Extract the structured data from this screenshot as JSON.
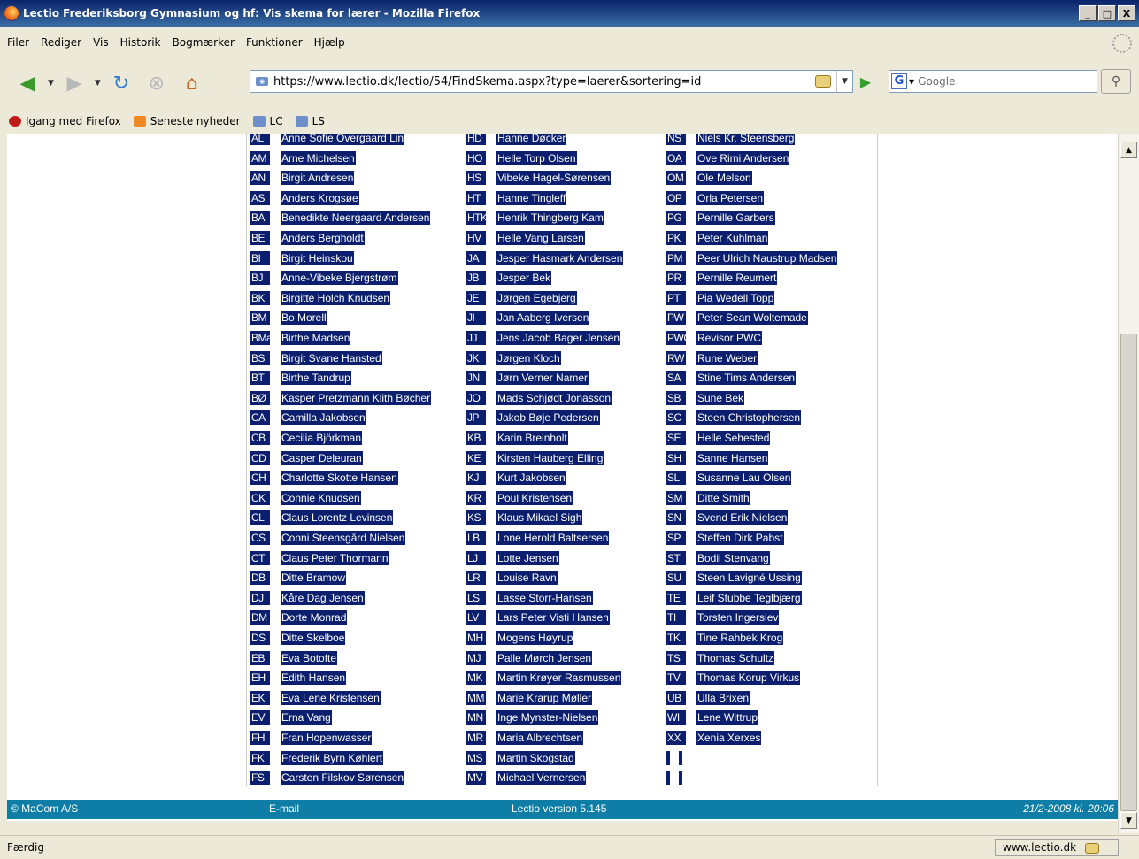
{
  "window": {
    "title": "Lectio Frederiksborg Gymnasium og hf: Vis skema for lærer - Mozilla Firefox",
    "controls": [
      "_",
      "□",
      "X"
    ]
  },
  "menu": [
    "Filer",
    "Rediger",
    "Vis",
    "Historik",
    "Bogmærker",
    "Funktioner",
    "Hjælp"
  ],
  "nav": {
    "url": "https://www.lectio.dk/lectio/54/FindSkema.aspx?type=laerer&sortering=id",
    "search_placeholder": "Google"
  },
  "bookmarks": [
    "Igang med Firefox",
    "Seneste nyheder",
    "LC",
    "LS"
  ],
  "teachers": {
    "col1": [
      [
        "AL",
        "Anne Sofie Overgaard Lin"
      ],
      [
        "AM",
        "Arne Michelsen"
      ],
      [
        "AN",
        "Birgit Andresen"
      ],
      [
        "AS",
        "Anders Krogsøe"
      ],
      [
        "BA",
        "Benedikte Neergaard Andersen"
      ],
      [
        "BE",
        "Anders Bergholdt"
      ],
      [
        "BI",
        "Birgit Heinskou"
      ],
      [
        "BJ",
        "Anne-Vibeke Bjergstrøm"
      ],
      [
        "BK",
        "Birgitte Holch Knudsen"
      ],
      [
        "BM",
        "Bo Morell"
      ],
      [
        "BMa",
        "Birthe Madsen"
      ],
      [
        "BS",
        "Birgit Svane Hansted"
      ],
      [
        "BT",
        "Birthe Tandrup"
      ],
      [
        "BØ",
        "Kasper Pretzmann Klith Bøcher"
      ],
      [
        "CA",
        "Camilla Jakobsen"
      ],
      [
        "CB",
        "Cecilia Björkman"
      ],
      [
        "CD",
        "Casper Deleuran"
      ],
      [
        "CH",
        "Charlotte Skotte Hansen"
      ],
      [
        "CK",
        "Connie Knudsen"
      ],
      [
        "CL",
        "Claus Lorentz Levinsen"
      ],
      [
        "CS",
        "Conni Steensgård Nielsen"
      ],
      [
        "CT",
        "Claus Peter Thormann"
      ],
      [
        "DB",
        "Ditte Bramow"
      ],
      [
        "DJ",
        "Kåre Dag Jensen"
      ],
      [
        "DM",
        "Dorte Monrad"
      ],
      [
        "DS",
        "Ditte Skelboe"
      ],
      [
        "EB",
        "Eva Botofte"
      ],
      [
        "EH",
        "Edith Hansen"
      ],
      [
        "EK",
        "Eva Lene Kristensen"
      ],
      [
        "EV",
        "Erna Vang"
      ],
      [
        "FH",
        "Fran Hopenwasser"
      ],
      [
        "FK",
        "Frederik Byrn Køhlert"
      ],
      [
        "FS",
        "Carsten Filskov Sørensen"
      ]
    ],
    "col2": [
      [
        "HD",
        "Hanne Døcker"
      ],
      [
        "HO",
        "Helle Torp Olsen"
      ],
      [
        "HS",
        "Vibeke Hagel-Sørensen"
      ],
      [
        "HT",
        "Hanne Tingleff"
      ],
      [
        "HTK",
        "Henrik Thingberg Kam"
      ],
      [
        "HV",
        "Helle Vang Larsen"
      ],
      [
        "JA",
        "Jesper Hasmark Andersen"
      ],
      [
        "JB",
        "Jesper Bek"
      ],
      [
        "JE",
        "Jørgen Egebjerg"
      ],
      [
        "JI",
        "Jan Aaberg Iversen"
      ],
      [
        "JJ",
        "Jens Jacob Bager Jensen"
      ],
      [
        "JK",
        "Jørgen Kloch"
      ],
      [
        "JN",
        "Jørn Verner Namer"
      ],
      [
        "JO",
        "Mads Schjødt Jonasson"
      ],
      [
        "JP",
        "Jakob Bøje Pedersen"
      ],
      [
        "KB",
        "Karin Breinholt"
      ],
      [
        "KE",
        "Kirsten Hauberg Elling"
      ],
      [
        "KJ",
        "Kurt Jakobsen"
      ],
      [
        "KR",
        "Poul Kristensen"
      ],
      [
        "KS",
        "Klaus Mikael Sigh"
      ],
      [
        "LB",
        "Lone Herold Baltsersen"
      ],
      [
        "LJ",
        "Lotte Jensen"
      ],
      [
        "LR",
        "Louise Ravn"
      ],
      [
        "LS",
        "Lasse Storr-Hansen"
      ],
      [
        "LV",
        "Lars Peter Visti Hansen"
      ],
      [
        "MH",
        "Mogens Høyrup"
      ],
      [
        "MJ",
        "Palle Mørch Jensen"
      ],
      [
        "MK",
        "Martin Krøyer Rasmussen"
      ],
      [
        "MM",
        "Marie Krarup Møller"
      ],
      [
        "MN",
        "Inge Mynster-Nielsen"
      ],
      [
        "MR",
        "Maria Albrechtsen"
      ],
      [
        "MS",
        "Martin Skogstad"
      ],
      [
        "MV",
        "Michael Vernersen"
      ]
    ],
    "col3": [
      [
        "NS",
        "Niels Kr. Steensberg"
      ],
      [
        "OA",
        "Ove Rimi Andersen"
      ],
      [
        "OM",
        "Ole Melson"
      ],
      [
        "OP",
        "Orla Petersen"
      ],
      [
        "PG",
        "Pernille Garbers"
      ],
      [
        "PK",
        "Peter Kuhlman"
      ],
      [
        "PM",
        "Peer Ulrich Naustrup Madsen"
      ],
      [
        "PR",
        "Pernille Reumert"
      ],
      [
        "PT",
        "Pia Wedell Topp"
      ],
      [
        "PW",
        "Peter Sean Woltemade"
      ],
      [
        "PWC",
        "Revisor PWC"
      ],
      [
        "RW",
        "Rune Weber"
      ],
      [
        "SA",
        "Stine Tims Andersen"
      ],
      [
        "SB",
        "Sune Bek"
      ],
      [
        "SC",
        "Steen Christophersen"
      ],
      [
        "SE",
        "Helle Sehested"
      ],
      [
        "SH",
        "Sanne Hansen"
      ],
      [
        "SL",
        "Susanne Lau Olsen"
      ],
      [
        "SM",
        "Ditte Smith"
      ],
      [
        "SN",
        "Svend Erik Nielsen"
      ],
      [
        "SP",
        "Steffen Dirk Pabst"
      ],
      [
        "ST",
        "Bodil Stenvang"
      ],
      [
        "SU",
        "Steen Lavigné Ussing"
      ],
      [
        "TE",
        "Leif Stubbe Teglbjærg"
      ],
      [
        "TI",
        "Torsten Ingerslev"
      ],
      [
        "TK",
        "Tine Rahbek Krog"
      ],
      [
        "TS",
        "Thomas Schultz"
      ],
      [
        "TV",
        "Thomas Korup Virkus"
      ],
      [
        "UB",
        "Ulla Brixen"
      ],
      [
        "WI",
        "Lene Wittrup"
      ],
      [
        "XX",
        "Xenia Xerxes"
      ],
      [
        "",
        ""
      ],
      [
        "",
        ""
      ]
    ]
  },
  "footer": {
    "copyright": "© MaCom A/S",
    "email": "E-mail",
    "version": "Lectio version 5.145",
    "date": "21/2-2008 kl. 20:06"
  },
  "status": {
    "text": "Færdig",
    "host": "www.lectio.dk"
  },
  "colors": {
    "highlight": "#0b1f6e",
    "footer": "#0e7ea6",
    "titlebar": "#0a246a"
  }
}
